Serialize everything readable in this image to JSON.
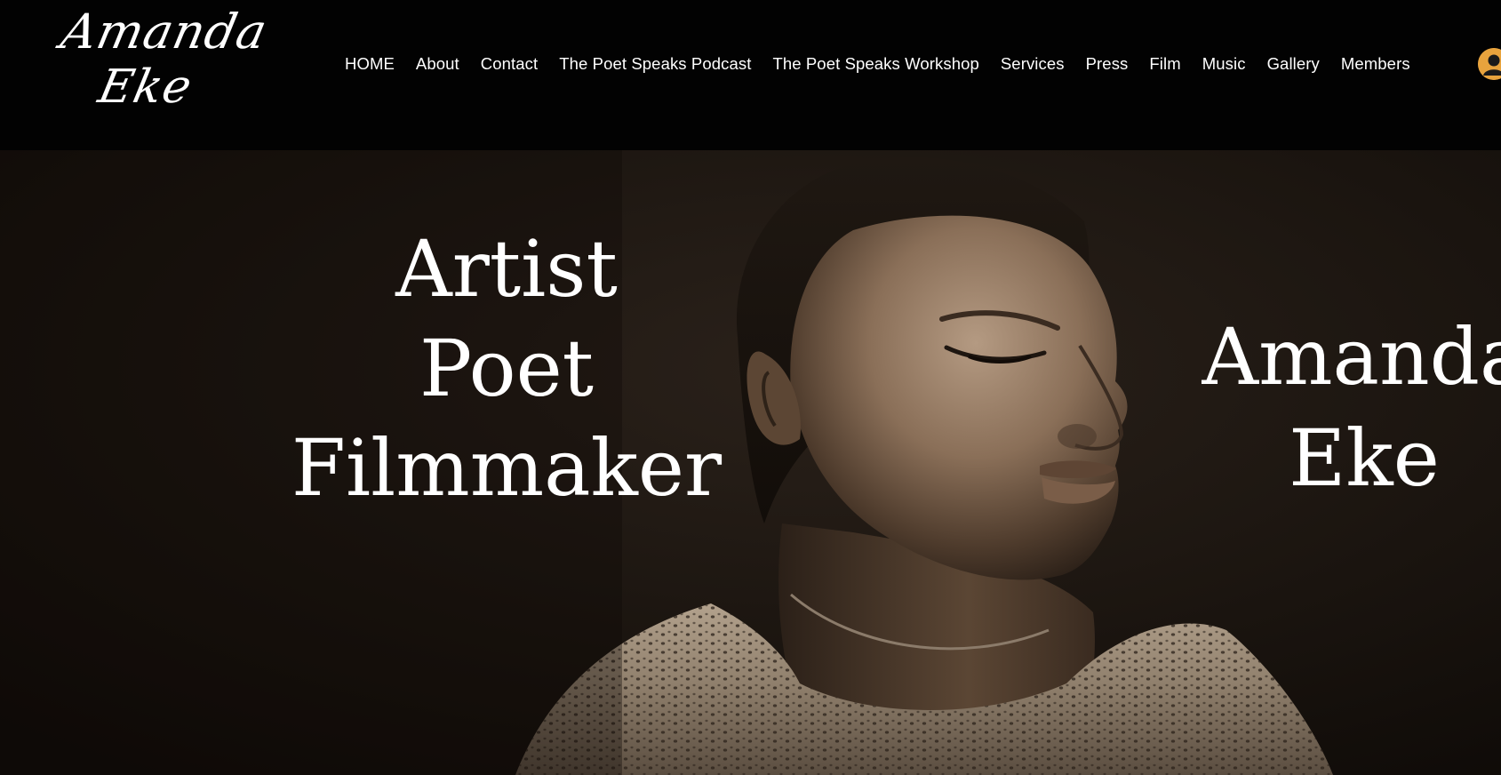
{
  "header": {
    "logo": {
      "line1": "Amanda",
      "line2": "Eke"
    },
    "nav": [
      {
        "label": "HOME"
      },
      {
        "label": "About"
      },
      {
        "label": "Contact"
      },
      {
        "label": "The Poet Speaks Podcast"
      },
      {
        "label": "The Poet Speaks Workshop"
      },
      {
        "label": "Services"
      },
      {
        "label": "Press"
      },
      {
        "label": "Film"
      },
      {
        "label": "Music"
      },
      {
        "label": "Gallery"
      },
      {
        "label": "Members"
      }
    ],
    "account_icon": "user-avatar-icon"
  },
  "hero": {
    "roles": [
      "Artist",
      "Poet",
      "Filmmaker"
    ],
    "name": [
      "Amanda",
      "Eke"
    ],
    "image": "portrait-photo"
  },
  "colors": {
    "header_bg": "#020202",
    "text": "#ffffff",
    "avatar_accent": "#e8a33d"
  }
}
